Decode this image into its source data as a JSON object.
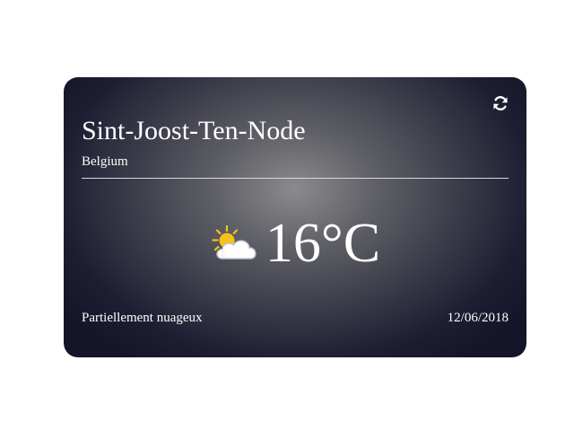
{
  "location": {
    "city": "Sint-Joost-Ten-Node",
    "country": "Belgium"
  },
  "weather": {
    "temperature": "16°C",
    "description": "Partiellement nuageux",
    "date": "12/06/2018",
    "icon": "partly-cloudy-icon"
  },
  "controls": {
    "refresh_icon": "refresh-icon"
  },
  "colors": {
    "card_center": "#8b8b8d",
    "card_edge": "#141529",
    "text": "#ffffff",
    "sun": "#f5c219",
    "cloud": "#ffffff"
  }
}
